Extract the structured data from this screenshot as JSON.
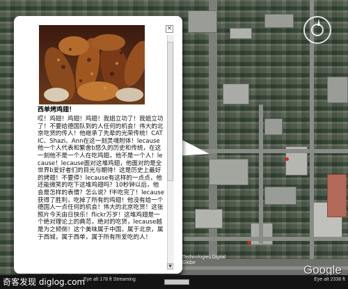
{
  "popup": {
    "close_label": "×",
    "title": "西单烤鸡翅！",
    "body": "哎！鸡翅！鸡翅！鸡翅！我姐立功了！我姐立功了！不要给德国队到的人任何的机会！伟大的北京吃货的传人！他继承了先辈的光荣传统！CATIC、Shazi、Ann在这一刻灵魂附体！lecause他一个人代表和繁舍b悠久的历史和传统，在这一刻他不是一个人在吃鸡翅，他不是一个人！lecause！lecause面对这堆鸡翅，他面对的是全世界b爱好者们的目光与期待！这是历史上最好的烤翅！不要停！lecause有这样的一点点，他还能微笑的吃下这堆鸡翅吗？10秒钟以后，他会是怎样的表情？怎么说？f半吃完了！lecause获得了胜利，吃掉了所有的鸡翅！他没有给一个德国人一点任何的机会！伟大的北京吃货！这张照片今天由日快乐！flickr万岁！这堆鸡翅是一个绝对理论上的典范，绝对的吃货，lecause越是为之倾倒！这个美味属于中国，属于北京，属于西城，属于西单，属于所有所爱吃的人！"
  },
  "status_bar": {
    "watermark": "奇客发现 diglog.com",
    "info": "Eye alt 178 ft  Streaming",
    "streaming_percent": 100,
    "right": "Eye alt  2338 ft"
  },
  "map": {
    "copyright": "Technologies Digital Globe",
    "logo": "Google"
  }
}
